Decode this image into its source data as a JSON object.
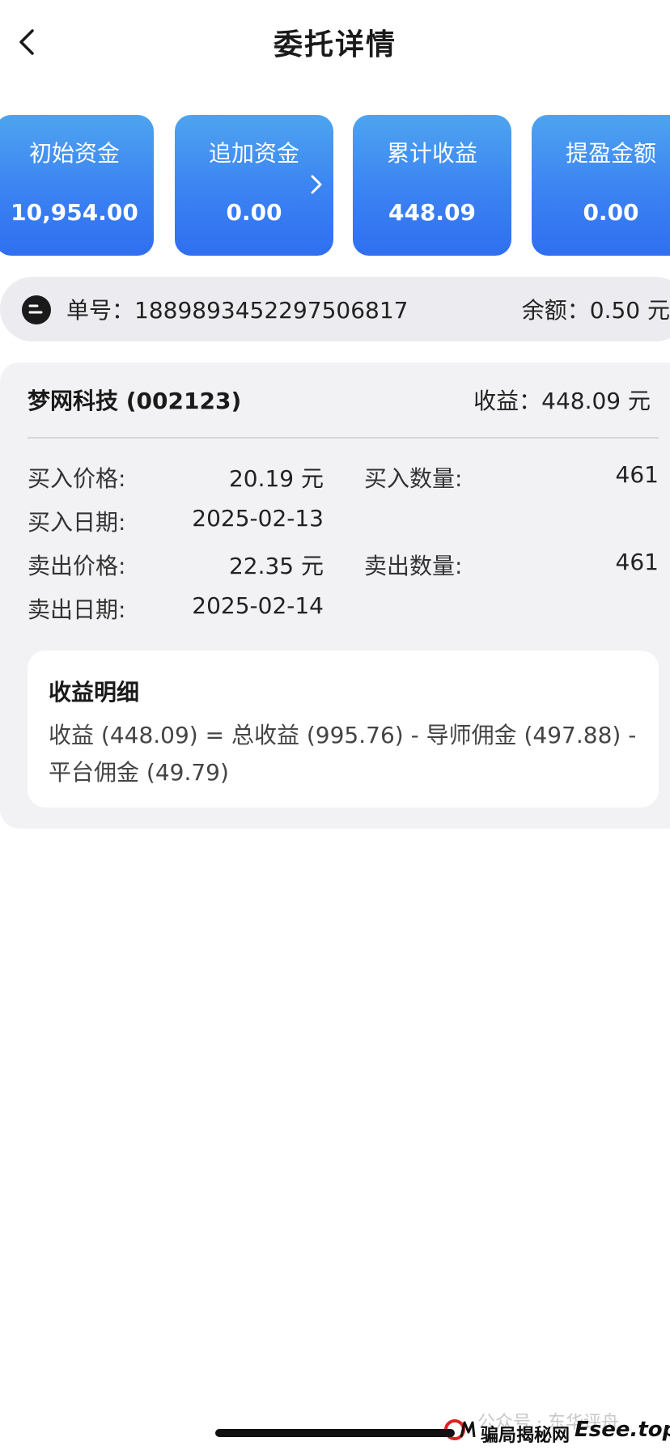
{
  "header": {
    "title": "委托详情"
  },
  "cards": [
    {
      "label": "初始资金",
      "value": "10,954.00"
    },
    {
      "label": "追加资金",
      "value": "0.00"
    },
    {
      "label": "累计收益",
      "value": "448.09"
    },
    {
      "label": "提盈金额",
      "value": "0.00"
    }
  ],
  "order": {
    "number_text": "单号：1889893452297506817",
    "balance_text": "余额：0.50 元"
  },
  "detail": {
    "stock_name": "梦网科技 (002123)",
    "profit_text": "收益：448.09 元",
    "buy_price_label": "买入价格:",
    "buy_price_value": "20.19 元",
    "buy_qty_label": "买入数量:",
    "buy_qty_value": "461",
    "buy_date_label": "买入日期:",
    "buy_date_value": "2025-02-13",
    "sell_price_label": "卖出价格:",
    "sell_price_value": "22.35 元",
    "sell_qty_label": "卖出数量:",
    "sell_qty_value": "461",
    "sell_date_label": "卖出日期:",
    "sell_date_value": "2025-02-14"
  },
  "breakdown": {
    "title": "收益明细",
    "text": "收益 (448.09) = 总收益 (995.76) - 导师佣金 (497.88) - 平台佣金 (49.79)"
  },
  "watermark": {
    "wechat_text": "公众号 · 东华评舟",
    "site_name": "骗局揭秘网",
    "domain": "Esee.top"
  },
  "colors": {
    "card_blue": "#3b82f2",
    "panel_gray": "#f2f2f5",
    "bar_gray": "#ececf0"
  },
  "icons": {
    "back": "chevron-left-icon",
    "card_arrow": "chevron-right-icon",
    "order": "order-badge-icon"
  }
}
